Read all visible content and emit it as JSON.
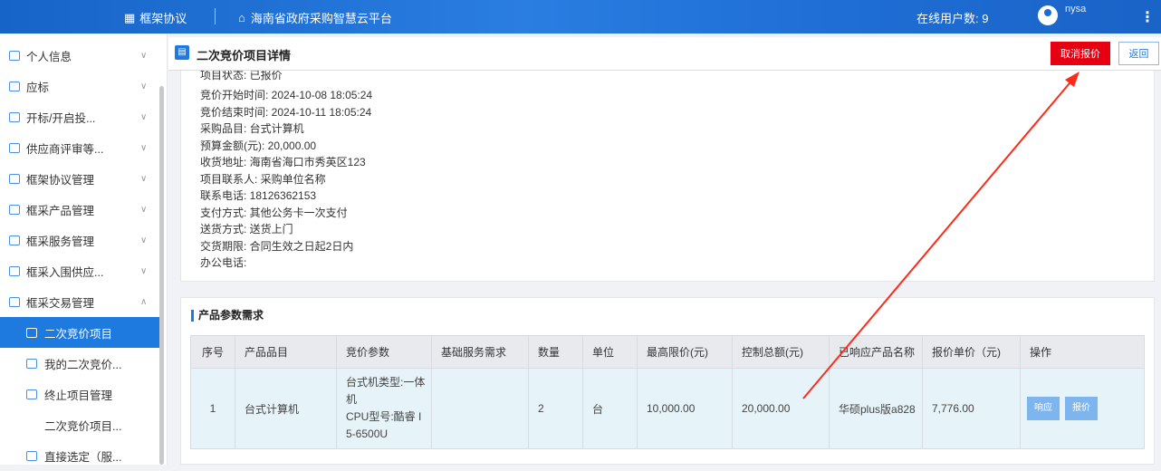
{
  "header": {
    "nav_primary": "框架协议",
    "nav_site": "海南省政府采购智慧云平台",
    "online_users": "在线用户数: 9",
    "username": "nysa"
  },
  "sidebar": {
    "items": [
      {
        "label": "个人信息",
        "icon": "user-card-icon"
      },
      {
        "label": "应标",
        "icon": "bid-icon"
      },
      {
        "label": "开标/开启投...",
        "icon": "open-bid-icon"
      },
      {
        "label": "供应商评审等...",
        "icon": "review-icon"
      },
      {
        "label": "框架协议管理",
        "icon": "contract-icon"
      },
      {
        "label": "框采产品管理",
        "icon": "product-icon"
      },
      {
        "label": "框采服务管理",
        "icon": "service-icon"
      },
      {
        "label": "框采入围供应...",
        "icon": "supplier-icon"
      },
      {
        "label": "框采交易管理",
        "icon": "trade-icon"
      }
    ],
    "sub_items": [
      {
        "label": "二次竞价项目",
        "icon": "auction-icon"
      },
      {
        "label": "我的二次竞价...",
        "icon": "my-bid-icon"
      },
      {
        "label": "终止项目管理",
        "icon": "terminate-icon"
      },
      {
        "label": "二次竞价项目...",
        "icon": ""
      },
      {
        "label": "直接选定（服...",
        "icon": "select-icon"
      }
    ]
  },
  "page": {
    "title": "二次竞价项目详情",
    "cancel_button": "取消报价",
    "back_button": "返回"
  },
  "info": {
    "partial_top": "项目状态: 已报价",
    "start_time": "竞价开始时间:  2024-10-08 18:05:24",
    "end_time": "竞价结束时间:  2024-10-11 18:05:24",
    "category": "采购品目:  台式计算机",
    "budget": "预算金额(元):  20,000.00",
    "address": "收货地址:  海南省海口市秀英区123",
    "contact": "项目联系人:  采购单位名称",
    "phone": "联系电话:  18126362153",
    "payment": "支付方式:  其他公务卡一次支付",
    "delivery": "送货方式:  送货上门",
    "deadline": "交货期限:  合同生效之日起2日内",
    "office_phone": "办公电话:"
  },
  "requirements": {
    "section_title": "产品参数需求",
    "columns": [
      "序号",
      "产品品目",
      "竞价参数",
      "基础服务需求",
      "数量",
      "单位",
      "最高限价(元)",
      "控制总额(元)",
      "已响应产品名称",
      "报价单价（元)",
      "操作"
    ],
    "rows": [
      {
        "index": "1",
        "category": "台式计算机",
        "spec_line1": "台式机类型:一体",
        "spec_line2": "机",
        "spec_line3": "CPU型号:酷睿 I",
        "spec_line4": "5-6500U",
        "service": "",
        "quantity": "2",
        "unit": "台",
        "max_price": "10,000.00",
        "total": "20,000.00",
        "product_name": "华硕plus版a828",
        "unit_price": "7,776.00",
        "action_respond": "响应",
        "action_quote": "报价"
      }
    ]
  },
  "colors": {
    "header": "#1f6fd6",
    "accent": "#1f7ae0",
    "danger": "#e60012",
    "annotation": "#ff2a1a"
  }
}
